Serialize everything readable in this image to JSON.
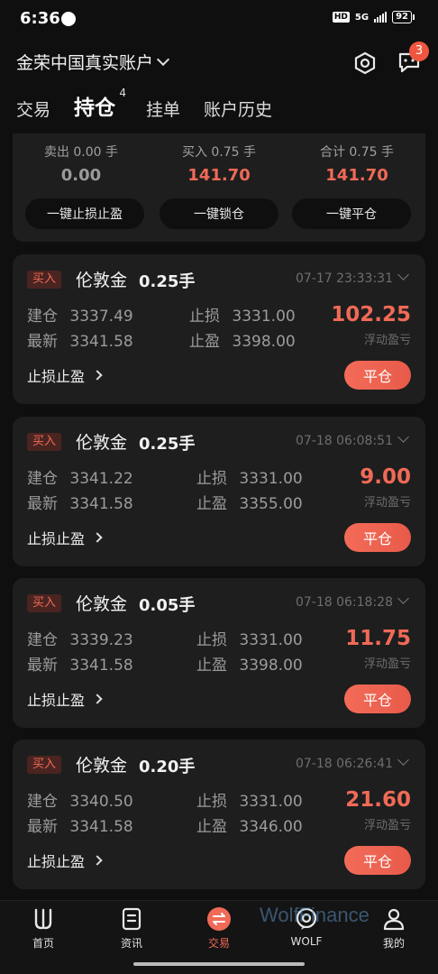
{
  "status_bar": {
    "time": "6:36",
    "hd": "HD",
    "network": "5G",
    "battery": "92"
  },
  "header": {
    "account_title": "金荣中国真实账户",
    "message_badge": "3"
  },
  "tabs": [
    {
      "label": "交易",
      "active": false
    },
    {
      "label": "持仓",
      "active": true,
      "sup": "4"
    },
    {
      "label": "挂单",
      "active": false
    },
    {
      "label": "账户历史",
      "active": false
    }
  ],
  "summary": {
    "sell_label": "卖出 0.00 手",
    "sell_value": "0.00",
    "buy_label": "买入 0.75 手",
    "buy_value": "141.70",
    "total_label": "合计 0.75 手",
    "total_value": "141.70",
    "btn_sltp": "一键止损止盈",
    "btn_lock": "一键锁仓",
    "btn_close_all": "一键平仓"
  },
  "positions": [
    {
      "side": "买入",
      "name": "伦敦金",
      "lots": "0.25手",
      "time": "07-17 23:33:31",
      "open_label": "建仓",
      "open": "3337.49",
      "latest_label": "最新",
      "latest": "3341.58",
      "sl_label": "止损",
      "sl": "3331.00",
      "tp_label": "止盈",
      "tp": "3398.00",
      "pnl": "102.25",
      "pnl_label": "浮动盈亏",
      "sltp_link": "止损止盈",
      "close_label": "平仓"
    },
    {
      "side": "买入",
      "name": "伦敦金",
      "lots": "0.25手",
      "time": "07-18 06:08:51",
      "open_label": "建仓",
      "open": "3341.22",
      "latest_label": "最新",
      "latest": "3341.58",
      "sl_label": "止损",
      "sl": "3331.00",
      "tp_label": "止盈",
      "tp": "3355.00",
      "pnl": "9.00",
      "pnl_label": "浮动盈亏",
      "sltp_link": "止损止盈",
      "close_label": "平仓"
    },
    {
      "side": "买入",
      "name": "伦敦金",
      "lots": "0.05手",
      "time": "07-18 06:18:28",
      "open_label": "建仓",
      "open": "3339.23",
      "latest_label": "最新",
      "latest": "3341.58",
      "sl_label": "止损",
      "sl": "3331.00",
      "tp_label": "止盈",
      "tp": "3398.00",
      "pnl": "11.75",
      "pnl_label": "浮动盈亏",
      "sltp_link": "止损止盈",
      "close_label": "平仓"
    },
    {
      "side": "买入",
      "name": "伦敦金",
      "lots": "0.20手",
      "time": "07-18 06:26:41",
      "open_label": "建仓",
      "open": "3340.50",
      "latest_label": "最新",
      "latest": "3341.58",
      "sl_label": "止损",
      "sl": "3331.00",
      "tp_label": "止盈",
      "tp": "3346.00",
      "pnl": "21.60",
      "pnl_label": "浮动盈亏",
      "sltp_link": "止损止盈",
      "close_label": "平仓"
    }
  ],
  "bottom_nav": [
    {
      "label": "首页",
      "icon": "home-logo-icon"
    },
    {
      "label": "资讯",
      "icon": "news-icon"
    },
    {
      "label": "交易",
      "icon": "trade-swap-icon",
      "active": true
    },
    {
      "label": "WOLF",
      "icon": "wolf-icon"
    },
    {
      "label": "我的",
      "icon": "profile-icon"
    }
  ],
  "watermark": "WolfFinance",
  "colors": {
    "accent_red": "#f06a57",
    "card_bg": "#1e1e1e",
    "page_bg": "#0f0f0f"
  }
}
